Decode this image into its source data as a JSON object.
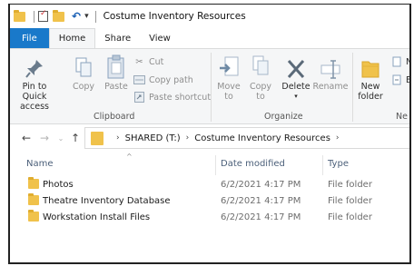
{
  "window": {
    "title": "Costume Inventory Resources"
  },
  "tabs": [
    "File",
    "Home",
    "Share",
    "View"
  ],
  "ribbon": {
    "clipboard": {
      "pin_line1": "Pin to Quick",
      "pin_line2": "access",
      "copy": "Copy",
      "paste": "Paste",
      "cut": "Cut",
      "copy_path": "Copy path",
      "paste_shortcut": "Paste shortcut",
      "label": "Clipboard"
    },
    "organize": {
      "move_to": "Move",
      "move_to_2": "to",
      "copy_to": "Copy",
      "copy_to_2": "to",
      "delete": "Delete",
      "rename": "Rename",
      "label": "Organize"
    },
    "new": {
      "new_folder_1": "New",
      "new_folder_2": "folder",
      "item_1": "N",
      "item_2": "Ea",
      "label": "Ne"
    }
  },
  "address": {
    "drive": "SHARED (T:)",
    "folder": "Costume Inventory Resources"
  },
  "columns": {
    "name": "Name",
    "date": "Date modified",
    "type": "Type"
  },
  "files": [
    {
      "name": "Photos",
      "date": "6/2/2021 4:17 PM",
      "type": "File folder"
    },
    {
      "name": "Theatre Inventory Database",
      "date": "6/2/2021 4:17 PM",
      "type": "File folder"
    },
    {
      "name": "Workstation Install Files",
      "date": "6/2/2021 4:17 PM",
      "type": "File folder"
    }
  ],
  "colors": {
    "file_tab": "#1979ca",
    "folder": "#f0c24b",
    "ribbon_bg": "#f5f6f7"
  }
}
